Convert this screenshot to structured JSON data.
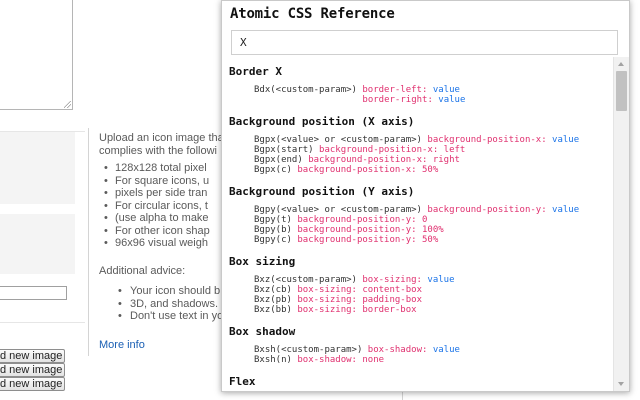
{
  "background": {
    "intro_lines": [
      "Upload an icon image tha",
      "complies with the followi"
    ],
    "bullets": [
      "128x128 total pixel",
      "For square icons, u",
      "pixels per side tran",
      "For circular icons, t",
      "(use alpha to make",
      "For other icon shap",
      "96x96 visual weigh"
    ],
    "advice_label": "Additional advice:",
    "advice_bullets": [
      "Your icon should b",
      "3D, and shadows.",
      "Don't use text in yo"
    ],
    "more_info": "More info",
    "upload_button_label": "d new image"
  },
  "popup": {
    "title": "Atomic CSS Reference",
    "search": {
      "value": "X"
    },
    "sections": [
      {
        "title": "Border X",
        "rows": [
          {
            "cls": "Bdx(<custom-param>)",
            "prop": "border-left:",
            "val": "value"
          },
          {
            "cls": "",
            "prop": "border-right:",
            "val": "value"
          }
        ]
      },
      {
        "title": "Background position (X axis)",
        "rows": [
          {
            "cls": "Bgpx(<value> or <custom-param>)",
            "prop": "background-position-x:",
            "val": "value"
          },
          {
            "cls": "Bgpx(start)",
            "prop": "background-position-x: left",
            "val": ""
          },
          {
            "cls": "Bgpx(end)",
            "prop": "background-position-x: right",
            "val": ""
          },
          {
            "cls": "Bgpx(c)",
            "prop": "background-position-x: 50%",
            "val": ""
          }
        ]
      },
      {
        "title": "Background position (Y axis)",
        "rows": [
          {
            "cls": "Bgpy(<value> or <custom-param>)",
            "prop": "background-position-y:",
            "val": "value"
          },
          {
            "cls": "Bgpy(t)",
            "prop": "background-position-y: 0",
            "val": ""
          },
          {
            "cls": "Bgpy(b)",
            "prop": "background-position-y: 100%",
            "val": ""
          },
          {
            "cls": "Bgpy(c)",
            "prop": "background-position-y: 50%",
            "val": ""
          }
        ]
      },
      {
        "title": "Box sizing",
        "rows": [
          {
            "cls": "Bxz(<custom-param>)",
            "prop": "box-sizing:",
            "val": "value"
          },
          {
            "cls": "Bxz(cb)",
            "prop": "box-sizing: content-box",
            "val": ""
          },
          {
            "cls": "Bxz(pb)",
            "prop": "box-sizing: padding-box",
            "val": ""
          },
          {
            "cls": "Bxz(bb)",
            "prop": "box-sizing: border-box",
            "val": ""
          }
        ]
      },
      {
        "title": "Box shadow",
        "rows": [
          {
            "cls": "Bxsh(<custom-param>)",
            "prop": "box-shadow:",
            "val": "value"
          },
          {
            "cls": "Bxsh(n)",
            "prop": "box-shadow: none",
            "val": ""
          }
        ]
      },
      {
        "title": "Flex",
        "rows": []
      }
    ]
  },
  "colors": {
    "property": "#e0306f",
    "value": "#1a73e8",
    "link": "#1a5fb4"
  }
}
